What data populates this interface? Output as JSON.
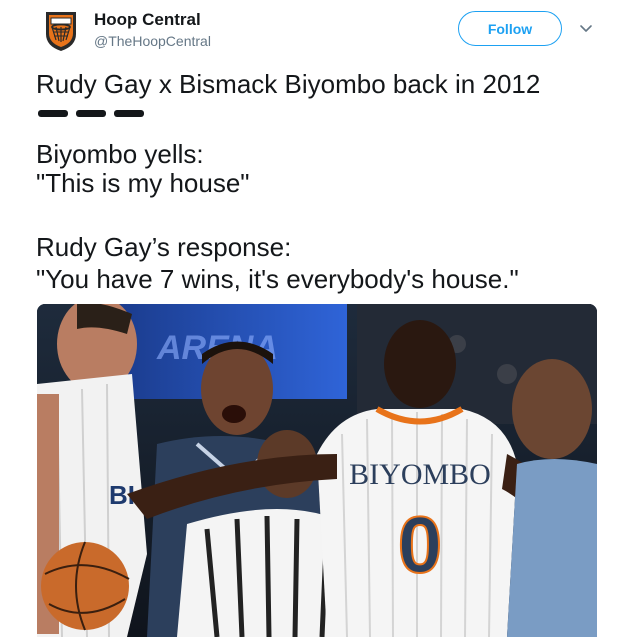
{
  "account": {
    "name": "Hoop Central",
    "handle": "@TheHoopCentral",
    "avatar_icon": "basketball-hoop-logo-icon",
    "colors": {
      "logo_dark": "#2a2a2a",
      "logo_orange": "#e8731a"
    }
  },
  "actions": {
    "follow_label": "Follow",
    "follow_color": "#1da1f2",
    "more_icon": "chevron-down-icon"
  },
  "tweet": {
    "line1": "Rudy Gay x Bismack Biyombo back in 2012",
    "line2": "Biyombo yells:",
    "line3": "\"This is my house\"",
    "line4": "Rudy Gay’s response:",
    "line5": "\"You have 7 wins, it's everybody's house.\""
  },
  "media": {
    "jersey_name": "BIYOMBO",
    "jersey_number": "0",
    "partial_jersey_letters": "BI"
  }
}
